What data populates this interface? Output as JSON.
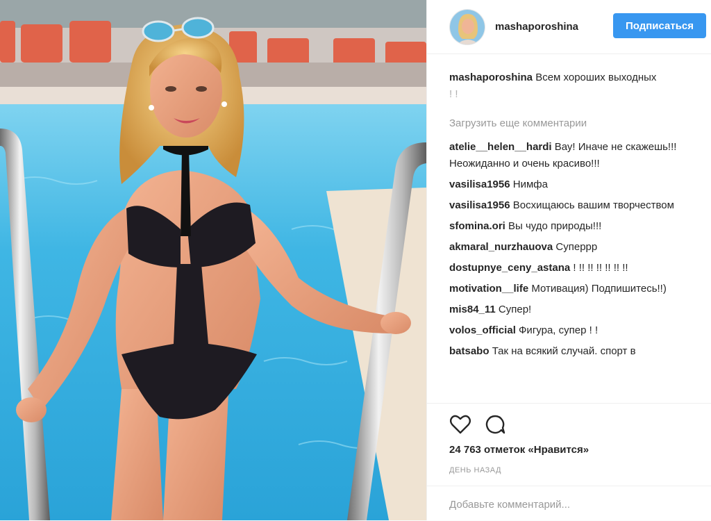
{
  "profile": {
    "username": "mashaporoshina",
    "follow_label": "Подписаться"
  },
  "caption": {
    "username": "mashaporoshina",
    "text": "Всем хороших выходных",
    "extra": "! !"
  },
  "load_more_label": "Загрузить еще комментарии",
  "comments": [
    {
      "user": "atelie__helen__hardi",
      "text": "Вау! Иначе не скажешь!!! Неожиданно и очень красиво!!!"
    },
    {
      "user": "vasilisa1956",
      "text": "Нимфа"
    },
    {
      "user": "vasilisa1956",
      "text": "Восхищаюсь вашим творчеством"
    },
    {
      "user": "sfomina.ori",
      "text": "Вы чудо природы!!!"
    },
    {
      "user": "akmaral_nurzhauova",
      "text": "Суперрр"
    },
    {
      "user": "dostupnye_ceny_astana",
      "text": "! !! !! !! !! !! !!"
    },
    {
      "user": "motivation__life",
      "text": "Мотивация) Подпишитесь!!)"
    },
    {
      "user": "mis84_11",
      "text": "Супер!"
    },
    {
      "user": "volos_official",
      "text": "Фигура, супер ! !"
    },
    {
      "user": "batsabo",
      "text": "Так на всякий случай. спорт в"
    }
  ],
  "icons": {
    "like": "heart-icon",
    "comment": "comment-bubble-icon"
  },
  "likes_text": "24 763 отметок «Нравится»",
  "age_text": "день назад",
  "add_comment_placeholder": "Добавьте комментарий...",
  "colors": {
    "follow_button": "#3897f0",
    "pool_water": "#3fb6e4",
    "text_primary": "#262626",
    "text_secondary": "#999999"
  }
}
